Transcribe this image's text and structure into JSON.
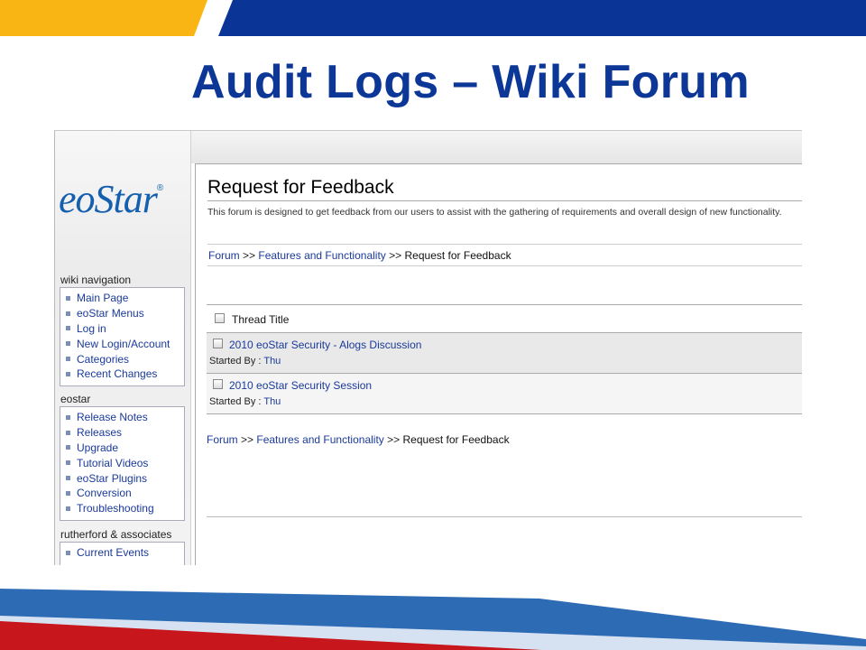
{
  "slide": {
    "title": "Audit Logs – Wiki Forum"
  },
  "sidebar": {
    "logo": {
      "text": "eoStar",
      "reg": "®"
    },
    "sections": [
      {
        "heading": "wiki navigation",
        "items": [
          "Main Page",
          "eoStar Menus",
          "Log in",
          "New Login/Account",
          "Categories",
          "Recent Changes"
        ]
      },
      {
        "heading": "eostar",
        "items": [
          "Release Notes",
          "Releases",
          "Upgrade",
          "Tutorial Videos",
          "eoStar Plugins",
          "Conversion",
          "Troubleshooting"
        ]
      },
      {
        "heading": "rutherford & associates",
        "items": [
          "Current Events"
        ]
      }
    ]
  },
  "page": {
    "heading": "Request for Feedback",
    "description": "This forum is designed to get feedback from our users to assist with the gathering of requirements and overall design of new functionality.",
    "breadcrumb": {
      "forum": "Forum",
      "sep": ">>",
      "category": "Features and Functionality",
      "current": "Request for Feedback"
    },
    "table": {
      "header": "Thread Title",
      "started_by_label": "Started By :",
      "threads": [
        {
          "title": "2010 eoStar Security - Alogs Discussion",
          "started_by": "Thu"
        },
        {
          "title": "2010 eoStar Security Session",
          "started_by": "Thu"
        }
      ]
    }
  },
  "colors": {
    "title_blue": "#0d3796",
    "banner_yellow": "#f8b514",
    "banner_blue": "#0a3596",
    "accent_red": "#c8161d",
    "accent_blue": "#2e6bb5",
    "link_blue": "#1a3a9a"
  }
}
